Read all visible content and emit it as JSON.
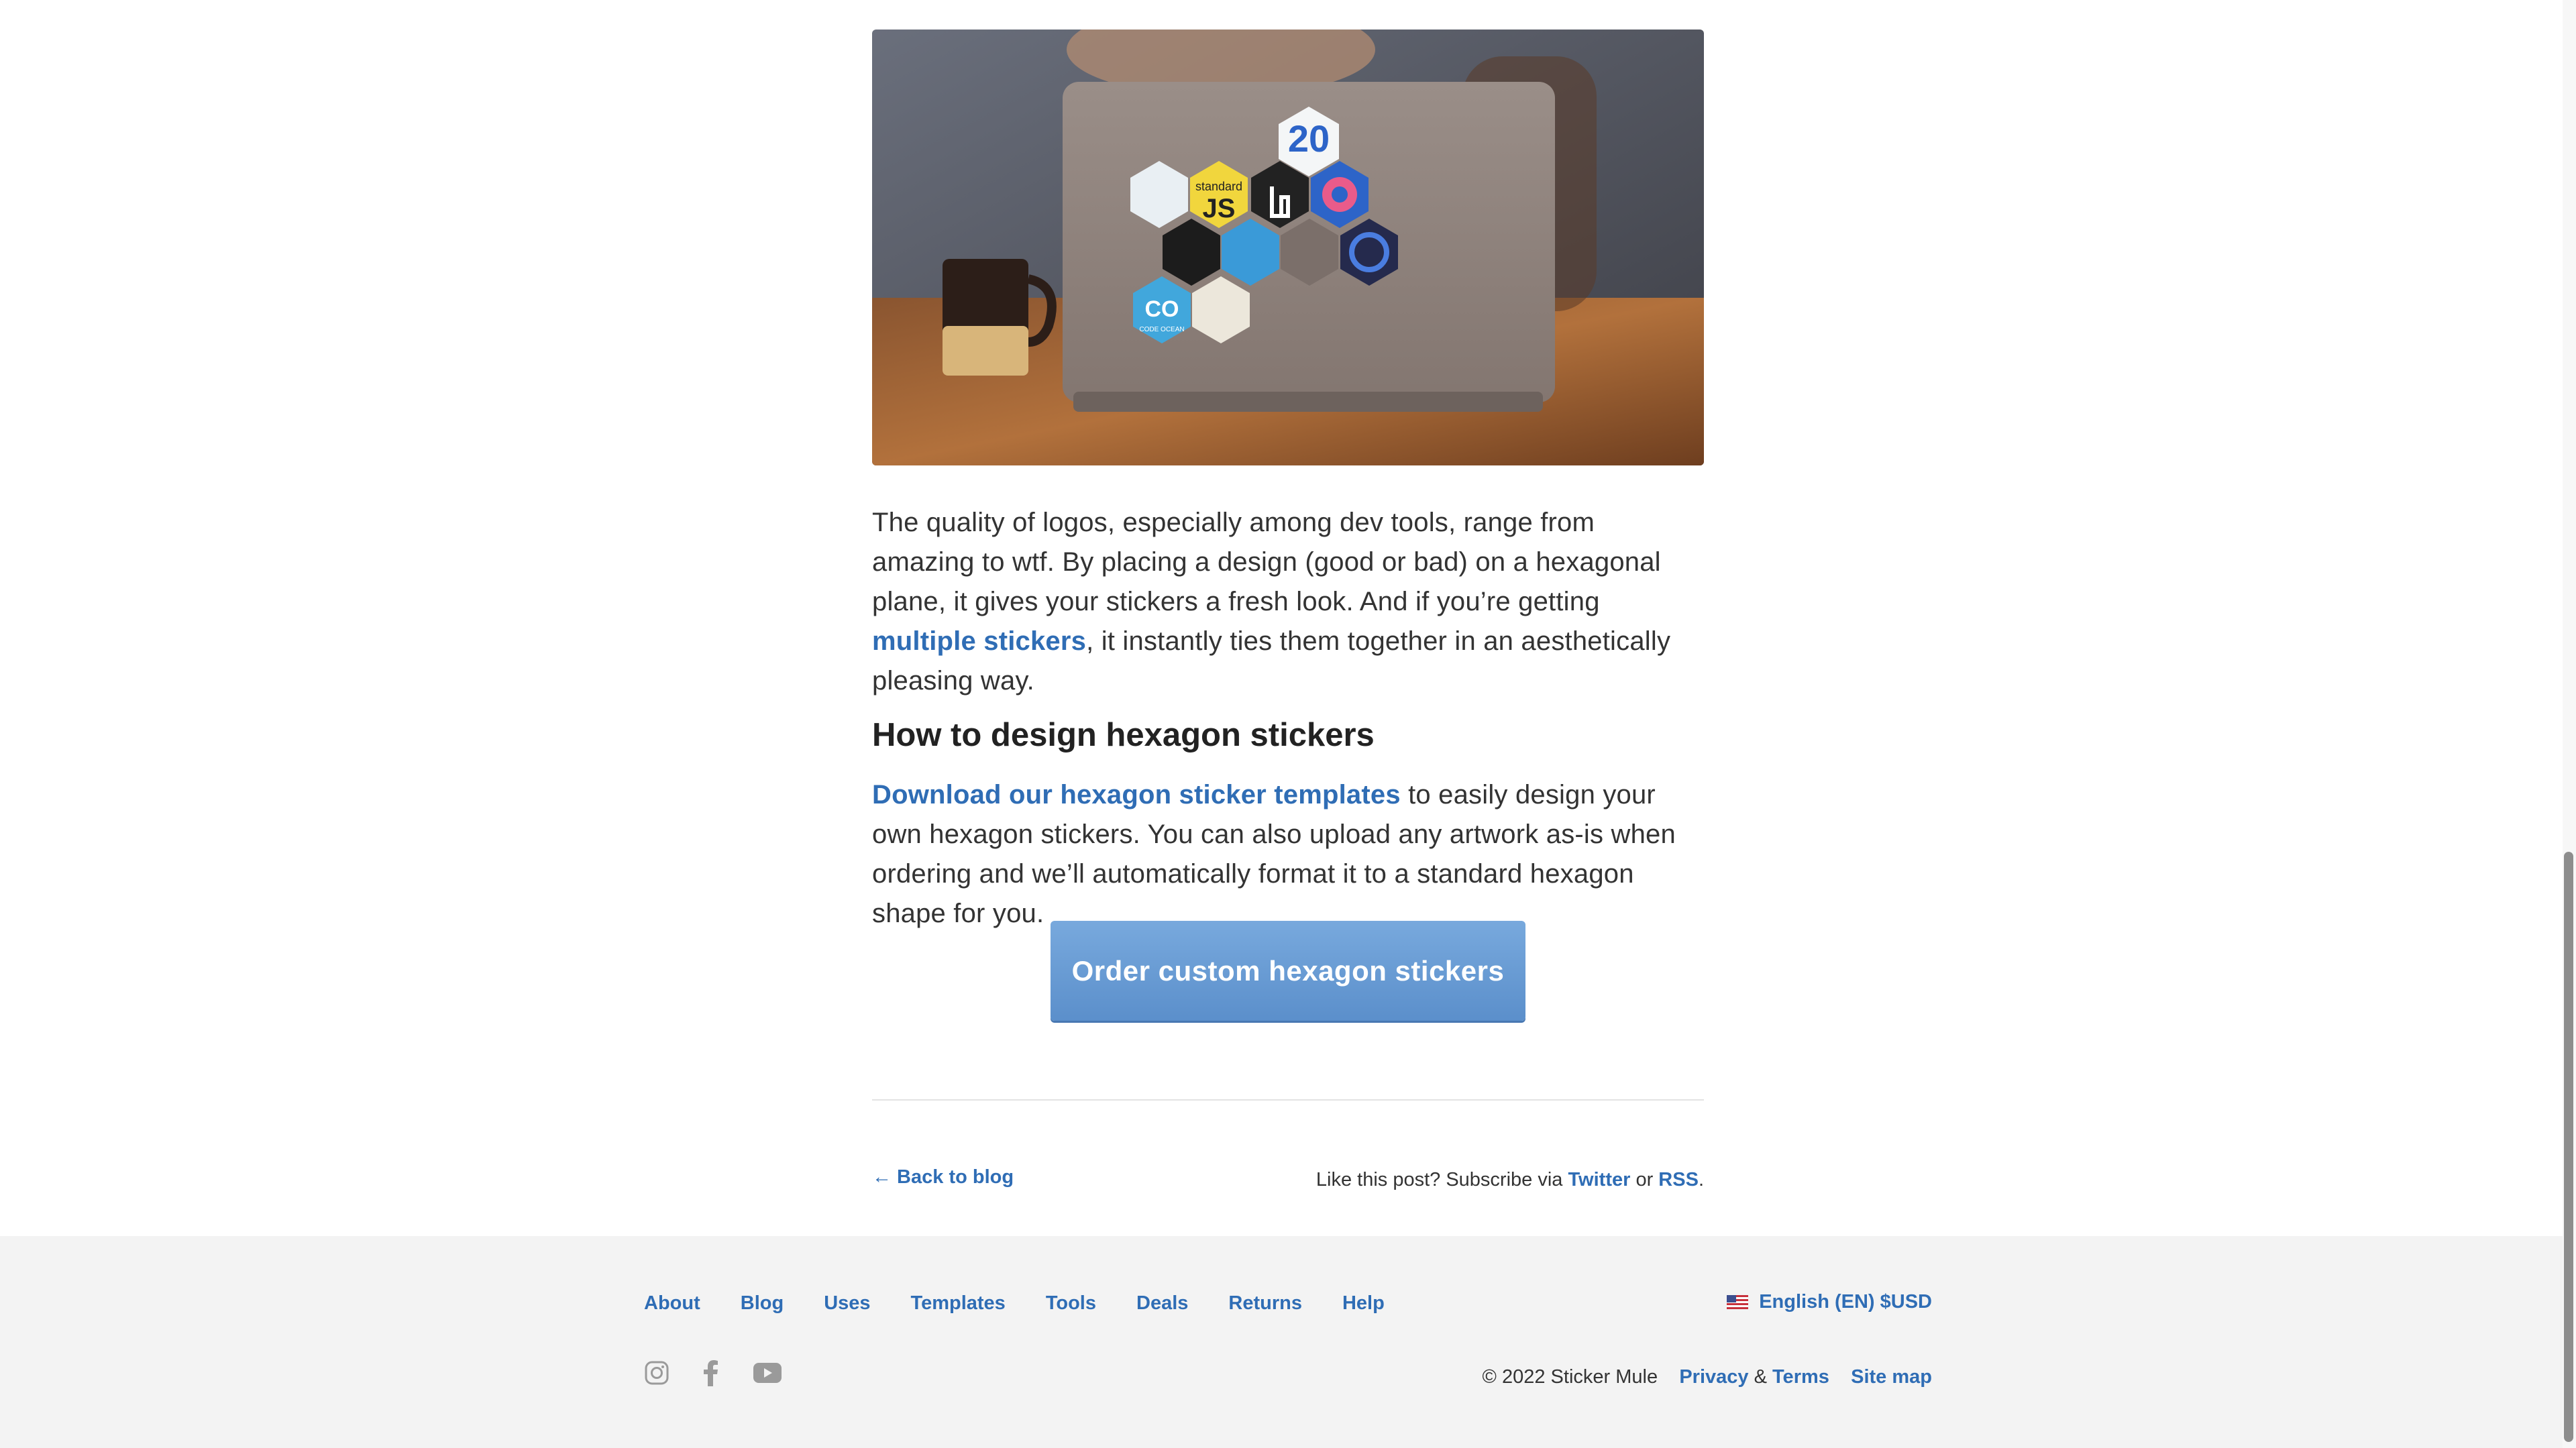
{
  "article": {
    "para1_part1": "The quality of logos, especially among dev tools, range from amazing to wtf. By placing a design (good or bad) on a hexagonal plane, it gives your stickers a fresh look. And if you’re getting ",
    "para1_link": "multiple stickers",
    "para1_part2": ", it instantly ties them together in an aesthetically pleasing way.",
    "heading": "How to design hexagon stickers",
    "para2_link": "Download our hexagon sticker templates",
    "para2_rest": " to easily design your own hexagon stickers. You can also upload any artwork as-is when ordering and we’ll automatically format it to a standard hexagon shape for you.",
    "cta_label": "Order custom hexagon stickers",
    "back_label": "← Back to blog",
    "subscribe_text": "Like this post? Subscribe via ",
    "subscribe_twitter": "Twitter",
    "subscribe_or": " or ",
    "subscribe_rss": "RSS",
    "subscribe_end": "."
  },
  "footer": {
    "nav": [
      "About",
      "Blog",
      "Uses",
      "Templates",
      "Tools",
      "Deals",
      "Returns",
      "Help"
    ],
    "locale_label": "English (EN) $USD",
    "copyright": "© 2022 Sticker Mule",
    "privacy": "Privacy",
    "amp": " & ",
    "terms": "Terms",
    "sitemap": "Site map",
    "social_icons": [
      "instagram-icon",
      "facebook-icon",
      "youtube-icon"
    ]
  },
  "hero_stickers": {
    "sticker_20": "20",
    "sticker_standard": "standard",
    "sticker_js": "JS",
    "sticker_co": "CO",
    "sticker_code_ocean": "CODE OCEAN"
  },
  "colors": {
    "link": "#2f6db5",
    "cta_top": "#78a9dd",
    "cta_bottom": "#5b8fcb",
    "footer_bg": "#f3f3f3"
  }
}
